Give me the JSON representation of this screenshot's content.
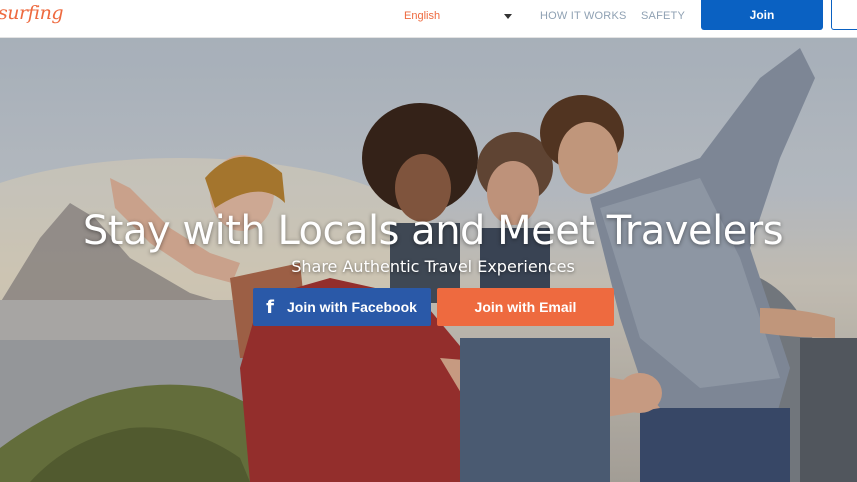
{
  "header": {
    "logo_text": "surfing",
    "language": "English",
    "nav": {
      "how_it_works": "HOW IT WORKS",
      "safety": "SAFETY"
    },
    "join_label": "Join"
  },
  "hero": {
    "headline": "Stay with Locals and Meet Travelers",
    "subheadline": "Share Authentic Travel Experiences",
    "facebook_button": "Join with Facebook",
    "email_button": "Join with Email"
  },
  "colors": {
    "accent_orange": "#ee6a3f",
    "join_blue": "#0a61c2",
    "facebook_blue": "#2a59a8"
  },
  "icons": {
    "facebook": "facebook-icon",
    "dropdown": "chevron-down-icon"
  }
}
